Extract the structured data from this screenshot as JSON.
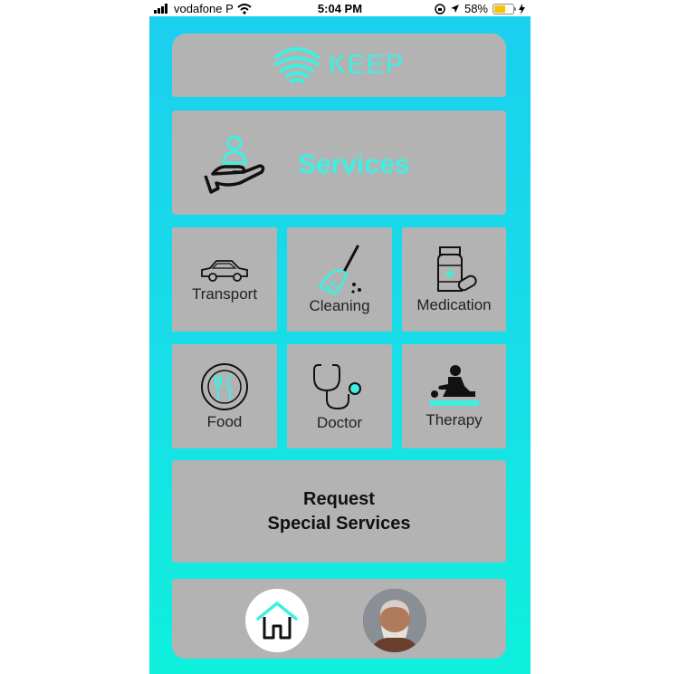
{
  "status_bar": {
    "carrier": "vodafone P",
    "time": "5:04 PM",
    "battery": "58%",
    "battery_level": 0.58
  },
  "header": {
    "logo_text": "KEEP"
  },
  "services_banner": {
    "label": "Services"
  },
  "tiles": [
    {
      "label": "Transport",
      "icon": "car-icon"
    },
    {
      "label": "Cleaning",
      "icon": "broom-icon"
    },
    {
      "label": "Medication",
      "icon": "medicine-bottle-icon"
    },
    {
      "label": "Food",
      "icon": "plate-cutlery-icon"
    },
    {
      "label": "Doctor",
      "icon": "stethoscope-icon"
    },
    {
      "label": "Therapy",
      "icon": "massage-icon"
    }
  ],
  "request": {
    "line1": "Request",
    "line2": "Special Services"
  },
  "bottom_nav": {
    "home_icon": "home-icon",
    "profile_icon": "avatar"
  },
  "colors": {
    "accent": "#3ef0e2",
    "card": "#b3b3b3",
    "gradient_top": "#1bcfee",
    "gradient_bottom": "#0ff0dc"
  }
}
